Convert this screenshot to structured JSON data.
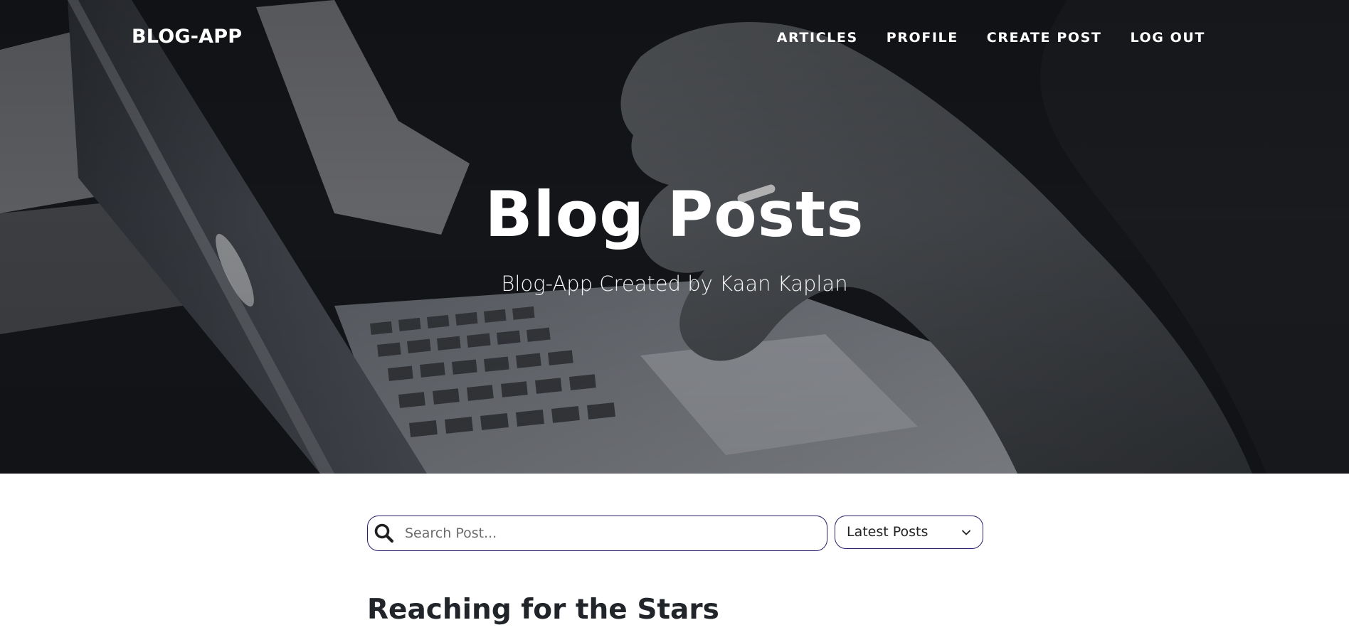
{
  "header": {
    "brand": "BLOG-APP",
    "nav": [
      {
        "label": "ARTICLES"
      },
      {
        "label": "PROFILE"
      },
      {
        "label": "CREATE POST"
      },
      {
        "label": "LOG OUT"
      }
    ]
  },
  "hero": {
    "title": "Blog Posts",
    "subtitle": "Blog-App Created by Kaan Kaplan"
  },
  "search": {
    "placeholder": "Search Post...",
    "value": "",
    "icon": "search-icon"
  },
  "sort": {
    "selected": "Latest Posts",
    "icon": "chevron-down-icon"
  },
  "posts": [
    {
      "title": "Reaching for the Stars"
    }
  ],
  "colors": {
    "accent_border": "#2a1f6b",
    "hero_bg": "#17191c",
    "text_dark": "#212529"
  }
}
